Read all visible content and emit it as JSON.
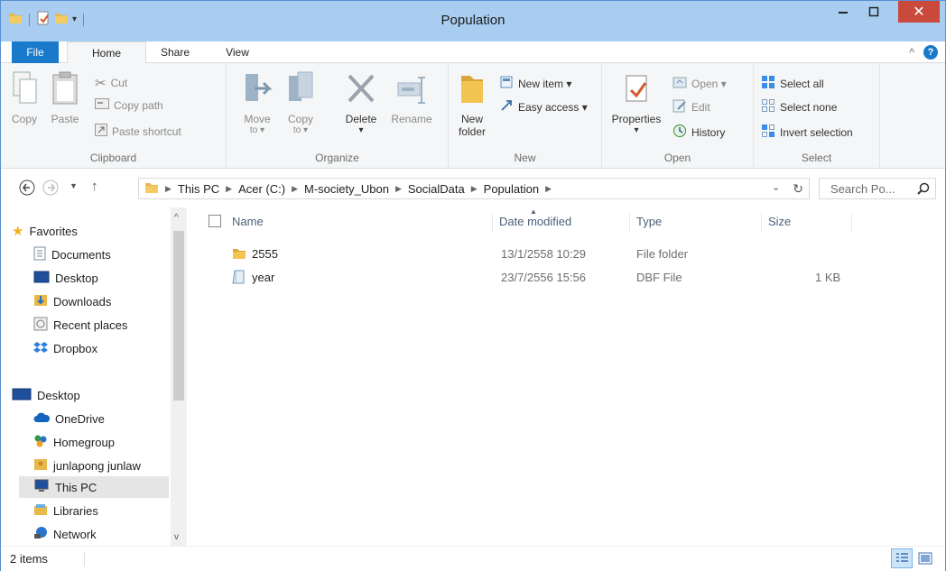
{
  "window": {
    "title": "Population"
  },
  "ribbon_tabs": {
    "file": "File",
    "home": "Home",
    "share": "Share",
    "view": "View"
  },
  "ribbon": {
    "clipboard": {
      "label": "Clipboard",
      "copy": "Copy",
      "paste": "Paste",
      "cut": "Cut",
      "copy_path": "Copy path",
      "paste_shortcut": "Paste shortcut"
    },
    "organize": {
      "label": "Organize",
      "move_to_line1": "Move",
      "move_to_line2": "to ▾",
      "copy_to_line1": "Copy",
      "copy_to_line2": "to ▾",
      "delete": "Delete",
      "delete_arrow": "▾",
      "rename": "Rename"
    },
    "new": {
      "label": "New",
      "new_folder_line1": "New",
      "new_folder_line2": "folder",
      "new_item": "New item ▾",
      "easy_access": "Easy access ▾"
    },
    "open": {
      "label": "Open",
      "properties": "Properties",
      "properties_arrow": "▾",
      "open": "Open ▾",
      "edit": "Edit",
      "history": "History"
    },
    "select": {
      "label": "Select",
      "select_all": "Select all",
      "select_none": "Select none",
      "invert_selection": "Invert selection"
    }
  },
  "address": {
    "crumbs": [
      "This PC",
      "Acer (C:)",
      "M-society_Ubon",
      "SocialData",
      "Population"
    ],
    "search_placeholder": "Search Po..."
  },
  "nav": {
    "favorites": "Favorites",
    "documents": "Documents",
    "desktop_fav": "Desktop",
    "downloads": "Downloads",
    "recent_places": "Recent places",
    "dropbox": "Dropbox",
    "desktop": "Desktop",
    "onedrive": "OneDrive",
    "homegroup": "Homegroup",
    "user": "junlapong junlaw",
    "this_pc": "This PC",
    "libraries": "Libraries",
    "network": "Network"
  },
  "columns": {
    "name": "Name",
    "date_modified": "Date modified",
    "type": "Type",
    "size": "Size"
  },
  "files": [
    {
      "name": "2555",
      "date": "13/1/2558 10:29",
      "type": "File folder",
      "size": "",
      "icon": "folder-icon"
    },
    {
      "name": "year",
      "date": "23/7/2556 15:56",
      "type": "DBF File",
      "size": "1 KB",
      "icon": "dbf-file-icon"
    }
  ],
  "status": {
    "count": "2 items"
  },
  "colors": {
    "titlebar": "#a8cdf0",
    "file_tab": "#1979ca",
    "close": "#c94a3c"
  }
}
